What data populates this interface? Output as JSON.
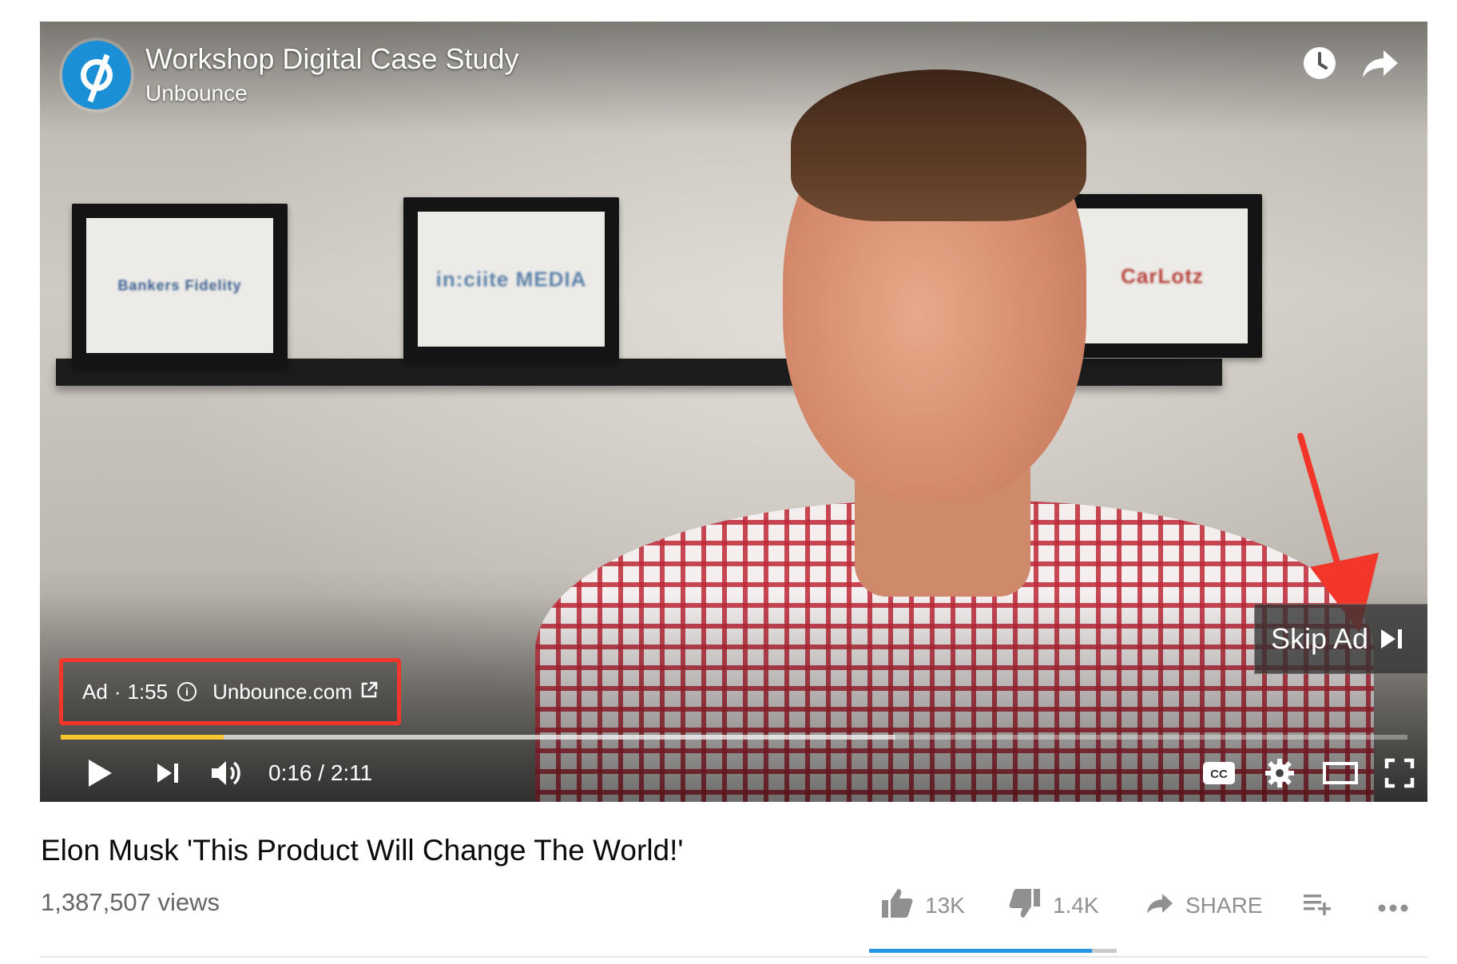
{
  "player": {
    "video_title": "Workshop Digital Case Study",
    "channel_name": "Unbounce",
    "wall_frames": [
      "Bankers Fidelity",
      "in:ciite MEDIA",
      "CarLotz"
    ],
    "ad": {
      "label": "Ad",
      "separator": "·",
      "remaining": "1:55",
      "advertiser_link": "Unbounce.com"
    },
    "skip_ad_label": "Skip Ad",
    "time": "0:16 / 2:11",
    "progress_played_fraction": 0.121,
    "highlight_color": "#f2362a",
    "progress_color": "#f7c52c"
  },
  "video": {
    "title": "Elon Musk 'This Product Will Change The World!'",
    "views": "1,387,507 views",
    "likes": "13K",
    "dislikes": "1.4K",
    "share_label": "SHARE",
    "like_ratio": 0.9
  },
  "icons": {
    "channel": "unbounce-logo-icon",
    "watch_later": "clock-icon",
    "share_top": "share-arrow-icon",
    "info": "info-icon",
    "external": "external-link-icon",
    "skip": "skip-next-icon",
    "play": "play-icon",
    "next": "next-icon",
    "volume": "volume-icon",
    "cc": "cc-icon",
    "settings": "gear-icon",
    "theater": "theater-mode-icon",
    "fullscreen": "fullscreen-icon",
    "like": "thumbs-up-icon",
    "dislike": "thumbs-down-icon",
    "add_to_playlist": "add-to-playlist-icon",
    "more": "more-icon"
  }
}
